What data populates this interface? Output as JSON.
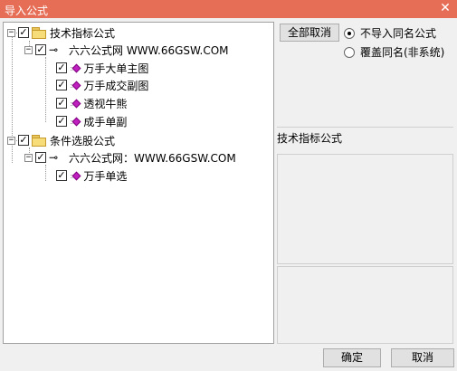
{
  "window": {
    "title": "导入公式",
    "close_glyph": "✕"
  },
  "tree": {
    "nodes": [
      {
        "label": "技术指标公式"
      },
      {
        "label": "六六公式网 WWW.66GSW.COM"
      },
      {
        "label": "万手大单主图"
      },
      {
        "label": "万手成交副图"
      },
      {
        "label": "透视牛熊"
      },
      {
        "label": "成手单副"
      },
      {
        "label": "条件选股公式"
      },
      {
        "label": "六六公式网：WWW.66GSW.COM"
      },
      {
        "label": "万手单选"
      }
    ],
    "expander_minus": "−",
    "check_mark": "✓",
    "key_glyph": "⊸"
  },
  "buttons": {
    "deselect_all": "全部取消",
    "ok": "确定",
    "cancel": "取消"
  },
  "options": {
    "no_import_same_name": "不导入同名公式",
    "overwrite_same_name": "覆盖同名(非系统)",
    "selected": "no_import_same_name"
  },
  "detail": {
    "category_label": "技术指标公式"
  },
  "colors": {
    "titlebar": "#e66e57",
    "item_icon": "#c020c0"
  }
}
